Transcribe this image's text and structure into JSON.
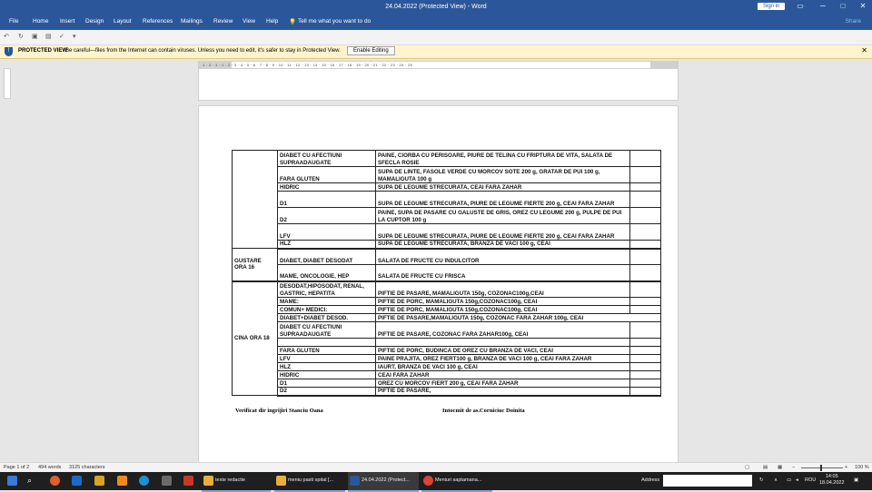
{
  "window": {
    "title": "24.04.2022 (Protected View) - Word",
    "sign_in": "Sign in"
  },
  "menu": [
    "File",
    "Home",
    "Insert",
    "Design",
    "Layout",
    "References",
    "Mailings",
    "Review",
    "View",
    "Help",
    "Tell me what you want to do"
  ],
  "share": "Share",
  "protected_view": {
    "title": "PROTECTED VIEW",
    "message": "Be careful—files from the Internet can contain viruses. Unless you need to edit, it's safer to stay in Protected View.",
    "button": "Enable Editing"
  },
  "ruler_numbers": "1 · 2 · 1 · 1 · 2 · 3 · 4 · 5 · 6 · 7 · 8 · 9 · 10 · 11 · 12 · 13 · 14 · 15 · 16 · 17 · 18 · 19 · 20 · 21 · 22 · 23 · 24 · 25",
  "table": {
    "groups": [
      {
        "label": "",
        "rows": [
          {
            "diet": "DIABET CU AFECTIUNI SUPRAADAUGATE",
            "meal": "PAINE, CIORBA CU PERISOARE, PIURE DE TELINA CU FRIPTURA DE VITA, SALATA DE SFECLA ROSIE"
          },
          {
            "diet": "FARA GLUTEN",
            "meal": "SUPA DE LINTE, FASOLE VERDE CU MORCOV SOTE 200 g, GRATAR DE PUI 100 g, MAMALIGUTA 100 g"
          },
          {
            "diet": "HIDRIC",
            "meal": "SUPA DE LEGUME STRECURATA, CEAI FARA ZAHAR"
          },
          {
            "diet": "D1",
            "meal": "SUPA DE LEGUME STRECURATA, PIURE DE LEGUME FIERTE 200 g, CEAI FARA ZAHAR"
          },
          {
            "diet": "D2",
            "meal": "PAINE, SUPA DE PASARE CU GALUSTE DE GRIS, OREZ CU LEGUME 200 g, PULPE DE PUI LA CUPTOR 100 g"
          },
          {
            "diet": "LFV",
            "meal": "SUPA DE LEGUME STRECURATA, PIURE DE LEGUME FIERTE 200 g, CEAI FARA ZAHAR"
          },
          {
            "diet": "HLZ",
            "meal": "SUPA DE LEGUME STRECURATA, BRANZA DE VACI 100 g, CEAI"
          }
        ]
      },
      {
        "label": "GUSTARE ORA 16",
        "rows": [
          {
            "diet": "DIABET, DIABET DESODAT",
            "meal": "SALATA DE FRUCTE CU INDULCITOR"
          },
          {
            "diet": "MAME, ONCOLOGIE, HEP",
            "meal": "SALATA DE FRUCTE CU FRISCA"
          }
        ]
      },
      {
        "label": "CINA ORA 18",
        "rows": [
          {
            "diet": "DESODAT,HIPOSODAT, RENAL, GASTRIC, HEPATITA",
            "meal": "PIFTIE DE PASARE, MAMALIGUTA 150g, COZONAC100g,CEAI"
          },
          {
            "diet": "MAME:",
            "meal": "PIFTIE DE PORC, MAMALIGUTA 150g,COZONAC100g, CEAI"
          },
          {
            "diet": "COMUN+ MEDICI:",
            "meal": "PIFTIE DE PORC, MAMALIGUTA 150g,COZONAC100g, CEAI"
          },
          {
            "diet": "DIABET+DIABET DESOD.",
            "meal": "PIFTIE DE PASARE,MAMALIGUTA 150g, COZONAC FARA ZAHAR 100g, CEAI"
          },
          {
            "diet": "DIABET CU AFECTIUNI SUPRAADAUGATE",
            "meal": "PIFTIE DE PASARE, COZONAC FARA ZAHAR100g, CEAI"
          },
          {
            "diet": "",
            "meal": ""
          },
          {
            "diet": "FARA GLUTEN",
            "meal": "PIFTIE DE PORC, BUDINCA DE OREZ CU BRANZA DE VACI, CEAI"
          },
          {
            "diet": "LFV",
            "meal": "PAINE PRAJITA, OREZ FIERT100 g, BRANZA DE VACI 100 g, CEAI FARA ZAHAR"
          },
          {
            "diet": "HLZ",
            "meal": "IAURT, BRANZA DE VACI 100 g, CEAI"
          },
          {
            "diet": "HIDRIC",
            "meal": "CEAI FARA ZAHAR"
          },
          {
            "diet": "D1",
            "meal": "OREZ CU MORCOV FIERT 200 g, CEAI FARA ZAHAR"
          },
          {
            "diet": "D2",
            "meal": "PIFTIE DE PASARE,"
          }
        ]
      }
    ]
  },
  "signatures": {
    "left": "Verificat dir ingrijiri  Stanciu Oana",
    "right": "Intocmit de as.Corniciuc Doinita"
  },
  "status": {
    "page": "Page 1 of 2",
    "words": "494 words",
    "chars": "3125 characters",
    "zoom": "100 %"
  },
  "taskbar": {
    "tasks": [
      {
        "label": "texte redactie",
        "color": "#e8b03a"
      },
      {
        "label": "meniu pasti spital [...",
        "color": "#e8b03a"
      },
      {
        "label": "24.04.2022 (Protect...",
        "color": "#2b579a"
      },
      {
        "label": "Meniuri saptamana...",
        "color": "#db4437"
      }
    ],
    "address_label": "Address",
    "lang": "ROU",
    "time": "14:05",
    "date": "18.04.2022"
  }
}
